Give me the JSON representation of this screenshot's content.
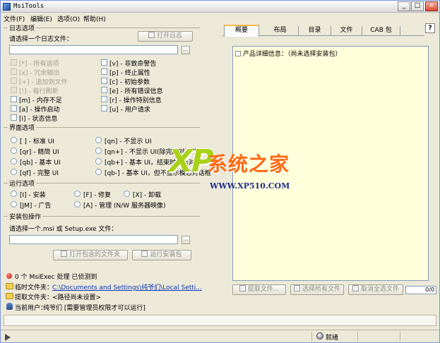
{
  "window": {
    "title": "MsiTools"
  },
  "menu": [
    "文件(F)",
    "编辑(E)",
    "选项(O)",
    "帮助(H)"
  ],
  "log_options": {
    "title": "日志选项",
    "choose_label": "请选择一个日志文件：",
    "open_log_button": "打开日志",
    "log_path_value": "",
    "browse_label": "...",
    "options": [
      {
        "label": "[*] - 所有选项",
        "enabled": false,
        "checked": true
      },
      {
        "label": "[v] - 非致命警告",
        "enabled": true,
        "checked": false
      },
      {
        "label": "[x] - 冗余输出",
        "enabled": false,
        "checked": true
      },
      {
        "label": "[p] - 终止属性",
        "enabled": true,
        "checked": false
      },
      {
        "label": "[+] - 追加到文件",
        "enabled": false,
        "checked": true
      },
      {
        "label": "[c] - 初始参数",
        "enabled": true,
        "checked": false
      },
      {
        "label": "[!] - 每行刷新",
        "enabled": false,
        "checked": true
      },
      {
        "label": "[e] - 所有错误信息",
        "enabled": true,
        "checked": false
      },
      {
        "label": "[m] - 内存不足",
        "enabled": true,
        "checked": false
      },
      {
        "label": "[r] - 操作特别信息",
        "enabled": true,
        "checked": false
      },
      {
        "label": "[a] - 操作启动",
        "enabled": true,
        "checked": false
      },
      {
        "label": "[u] - 用户请求",
        "enabled": true,
        "checked": false
      },
      {
        "label": "[i] - 状态信息",
        "enabled": true,
        "checked": false
      }
    ]
  },
  "ui_options": {
    "title": "界面选项",
    "options": [
      "[ ] - 标准 UI",
      "[qn] - 不显示 UI",
      "[qr] - 精简 UI",
      "[qn+] - 不显示 UI(除完成对话外)",
      "[qb] - 基本 UI",
      "[qb+] - 基本 UI，结束时显示对话框",
      "[qf] - 完整 UI",
      "[qb-] - 基本 UI，但不显示模态对话框"
    ]
  },
  "run_options": {
    "title": "运行选项",
    "options": [
      "[I] - 安装",
      "[F] - 修复",
      "[X] - 卸载",
      "[JM] - 广告",
      "[A] - 管理 (N/W 服务器映像)"
    ]
  },
  "package_ops": {
    "title": "安装包操作",
    "choose_label": "请选择一个.msi 或 Setup.exe 文件：",
    "path_value": "",
    "browse_label": "...",
    "open_folder_button": "打开包含的文件夹",
    "run_installer_button": "运行安装包"
  },
  "status": {
    "msiexec": "0 个 MsiExec 处理  已侦测到",
    "temp_label": "临时文件夹：",
    "temp_path": "C:\\Documents and Settings\\纯爷们\\Local Setti...",
    "extract_label": "提取文件夹：",
    "extract_value": "<路径尚未设置>",
    "user_label": "当前用户：",
    "user_value": "纯爷们  [需要管理员权限才可以运行]"
  },
  "tabs": [
    "概要",
    "布局",
    "目录",
    "文件",
    "CAB 包"
  ],
  "active_tab": "概要",
  "help_label": "?",
  "detail": {
    "root_text": "产品详细信息：（尚未选择安装包）"
  },
  "file_buttons": {
    "extract": "提取文件...",
    "select_all": "选择所有文件",
    "deselect_all": "取消全选文件",
    "counter": "0/0"
  },
  "statusbar": {
    "ready": "就绪"
  },
  "watermark": {
    "xp": "XP",
    "brand": "系统之家",
    "url": "WWW.XP510.COM"
  },
  "window_buttons": {
    "min": "_",
    "max": "□",
    "close": "×"
  }
}
